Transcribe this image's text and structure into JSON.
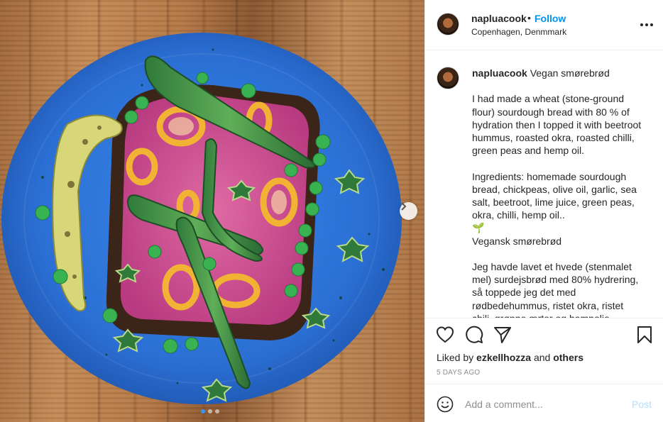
{
  "post": {
    "username": "napluacook",
    "follow_separator": "•",
    "follow_label": "Follow",
    "location": "Copenhagen, Denmmark",
    "more_icon": "more-options-icon"
  },
  "caption": {
    "username": "napluacook",
    "text": "Vegan smørebrød\n\nI had made a wheat (stone-ground flour) sourdough bread with 80 % of hydration then I topped it with beetroot hummus, roasted okra, roasted chilli, green peas and hemp oil.\n\nIngredients: homemade sourdough bread, chickpeas, olive oil, garlic, sea salt, beetroot, lime juice, green peas, okra, chilli, hemp oil..\n🌱\nVegansk smørebrød\n\nJeg havde lavet et hvede (stenmalet mel) surdejsbrød med 80% hydrering, så toppede jeg det med rødbedehummus, ristet okra, ristet chili, grønne ærter og hampolie."
  },
  "actions": {
    "icons": [
      "heart-icon",
      "comment-icon",
      "share-icon",
      "bookmark-icon"
    ]
  },
  "likes": {
    "prefix": "Liked by",
    "user": "ezkellhozza",
    "joiner": "and",
    "others": "others"
  },
  "timestamp": "5 DAYS AGO",
  "comment": {
    "placeholder": "Add a comment...",
    "post_label": "Post"
  },
  "carousel": {
    "slides": 3,
    "current": 1
  },
  "colors": {
    "link_blue": "#0095f6",
    "post_disabled": "#b2dffc",
    "plate_blue": "#2a6fd6",
    "border": "#efefef"
  }
}
